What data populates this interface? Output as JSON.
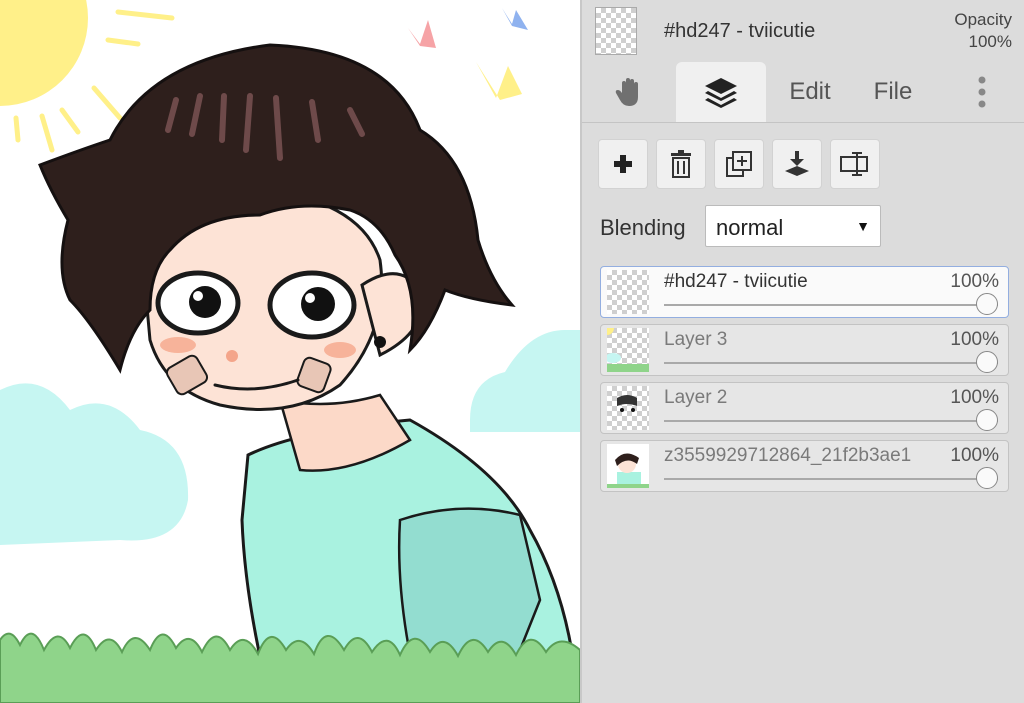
{
  "header": {
    "active_layer_name": "#hd247 - tviicutie",
    "opacity_label": "Opacity",
    "opacity_value": "100%"
  },
  "tabs": {
    "hand_icon": "hand-icon",
    "layers_icon": "layers-icon",
    "edit": "Edit",
    "file": "File",
    "more_icon": "more-vertical-icon"
  },
  "toolbar": {
    "icons": [
      "plus-icon",
      "trash-icon",
      "duplicate-icon",
      "merge-down-icon",
      "rename-icon"
    ]
  },
  "blending": {
    "label": "Blending",
    "value": "normal"
  },
  "layers": [
    {
      "name": "#hd247 - tviicutie",
      "opacity": "100%",
      "opacity_level": 1.0,
      "selected": true
    },
    {
      "name": "Layer 3",
      "opacity": "100%",
      "opacity_level": 1.0,
      "selected": false
    },
    {
      "name": "Layer 2",
      "opacity": "100%",
      "opacity_level": 1.0,
      "selected": false
    },
    {
      "name": "z3559929712864_21f2b3ae1",
      "opacity": "100%",
      "opacity_level": 1.0,
      "selected": false
    }
  ],
  "colors": {
    "panel_bg": "#dcdcdc",
    "selected_border": "#93aee0",
    "sun": "#fff089",
    "hair": "#2e1f1c",
    "shirt": "#a9f2e0",
    "cloud": "#c6f6f2",
    "grass": "#8fd48a"
  }
}
